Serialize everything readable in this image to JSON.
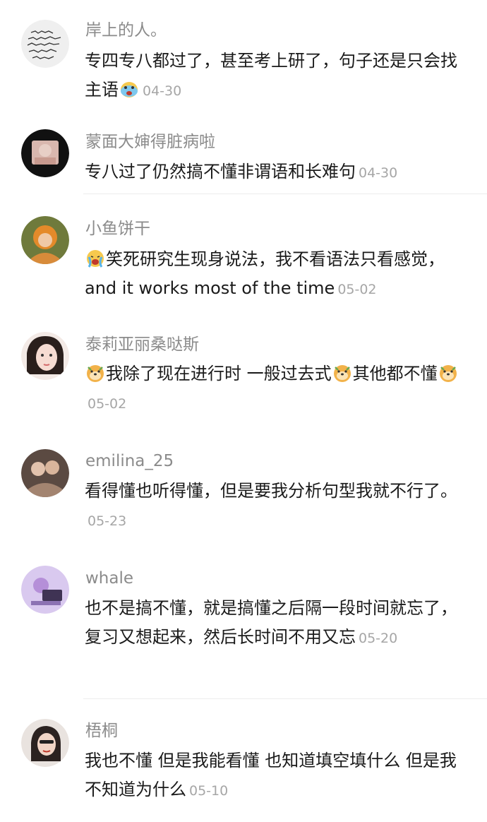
{
  "comments": [
    {
      "username": "岸上的人。",
      "text_1": "专四专八都过了，甚至考上研了，句子还是只会找主语",
      "date": "04-30",
      "avatar_icon": "handwriting-avatar-icon",
      "emoji": "crying-face-icon"
    },
    {
      "username": "蒙面大婶得脏病啦",
      "text_1": "专八过了仍然搞不懂非谓语和长难句",
      "date": "04-30",
      "avatar_icon": "photo-avatar-icon"
    },
    {
      "username": "小鱼饼干",
      "text_1": "笑死研究生现身说法，我不看语法只看感觉，and it works most of the time",
      "date": "05-02",
      "avatar_icon": "photo-avatar-icon",
      "emoji": "crying-face-icon"
    },
    {
      "username": "泰莉亚丽桑哒斯",
      "text_1": "我除了现在进行时 一般过去式",
      "text_2": "其他都不懂",
      "date": "05-02",
      "avatar_icon": "photo-avatar-icon",
      "emoji": "doge-icon"
    },
    {
      "username": "emilina_25",
      "text_1": "看得懂也听得懂，但是要我分析句型我就不行了。",
      "date": "05-23",
      "avatar_icon": "photo-avatar-icon"
    },
    {
      "username": "whale",
      "text_1": "也不是搞不懂，就是搞懂之后隔一段时间就忘了，复习又想起来，然后长时间不用又忘",
      "date": "05-20",
      "avatar_icon": "photo-avatar-icon"
    },
    {
      "username": "梧桐",
      "text_1": "我也不懂 但是我能看懂 也知道填空填什么 但是我不知道为什么",
      "date": "05-10",
      "avatar_icon": "photo-avatar-icon"
    }
  ]
}
